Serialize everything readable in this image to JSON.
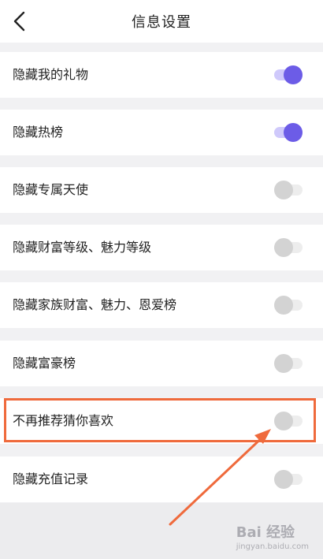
{
  "header": {
    "title": "信息设置",
    "back_icon": "chevron-left-icon"
  },
  "settings": [
    {
      "label": "隐藏我的礼物",
      "enabled": true
    },
    {
      "label": "隐藏热榜",
      "enabled": true
    },
    {
      "label": "隐藏专属天使",
      "enabled": false
    },
    {
      "label": "隐藏财富等级、魅力等级",
      "enabled": false
    },
    {
      "label": "隐藏家族财富、魅力、恩爱榜",
      "enabled": false
    },
    {
      "label": "隐藏富豪榜",
      "enabled": false
    },
    {
      "label": "不再推荐猜你喜欢",
      "enabled": false
    },
    {
      "label": "隐藏充值记录",
      "enabled": false
    }
  ],
  "colors": {
    "toggle_on": "#6c5ce7",
    "toggle_on_track": "#cfc9fb",
    "toggle_off_knob": "#d3d3d3",
    "toggle_off_track": "#ededed",
    "highlight": "#ef6a3c",
    "background": "#f1f1f3"
  },
  "watermark": {
    "brand": "Bai 经验",
    "url": "jingyan.baidu.com"
  }
}
